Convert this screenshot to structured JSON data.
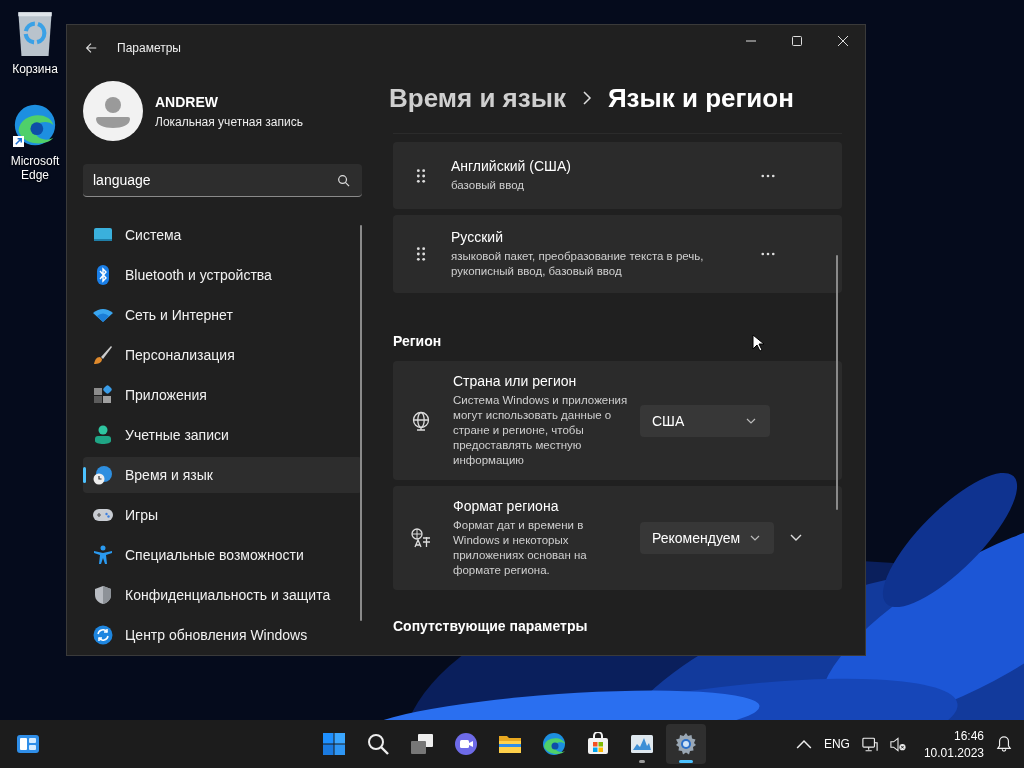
{
  "desktop_icons": [
    {
      "kind": "recycle",
      "label": "Корзина"
    },
    {
      "kind": "edge",
      "label": "Microsoft Edge"
    }
  ],
  "window": {
    "title": "Параметры"
  },
  "user": {
    "name": "ANDREW",
    "account_type": "Локальная учетная запись"
  },
  "search": {
    "value": "language"
  },
  "nav": [
    {
      "kind": "system",
      "label": "Система",
      "selected": false
    },
    {
      "kind": "bluetooth",
      "label": "Bluetooth и устройства",
      "selected": false
    },
    {
      "kind": "network",
      "label": "Сеть и Интернет",
      "selected": false
    },
    {
      "kind": "personalization",
      "label": "Персонализация",
      "selected": false
    },
    {
      "kind": "apps",
      "label": "Приложения",
      "selected": false
    },
    {
      "kind": "accounts",
      "label": "Учетные записи",
      "selected": false
    },
    {
      "kind": "time",
      "label": "Время и язык",
      "selected": true
    },
    {
      "kind": "gaming",
      "label": "Игры",
      "selected": false
    },
    {
      "kind": "accessibility",
      "label": "Специальные возможности",
      "selected": false
    },
    {
      "kind": "privacy",
      "label": "Конфиденциальность и защита",
      "selected": false
    },
    {
      "kind": "update",
      "label": "Центр обновления Windows",
      "selected": false
    }
  ],
  "breadcrumb": {
    "parent": "Время и язык",
    "current": "Язык и регион"
  },
  "languages": [
    {
      "name": "Английский (США)",
      "features": "базовый ввод"
    },
    {
      "name": "Русский",
      "features": "языковой пакет, преобразование текста в речь, рукописный ввод, базовый ввод"
    }
  ],
  "region": {
    "heading": "Регион",
    "settings": [
      {
        "kind": "globe",
        "title": "Страна или регион",
        "description": "Система Windows и приложения могут использовать данные о стране и регионе, чтобы предоставлять местную информацию",
        "value": "США",
        "expandable": false
      },
      {
        "kind": "format",
        "title": "Формат региона",
        "description": "Формат дат и времени в Windows и некоторых приложениях основан на формате региона.",
        "value": "Рекомендуем",
        "expandable": true
      }
    ]
  },
  "related_heading": "Сопутствующие параметры",
  "taskbar": {
    "apps": [
      {
        "kind": "start",
        "running": false,
        "selected": false
      },
      {
        "kind": "search",
        "running": false,
        "selected": false
      },
      {
        "kind": "taskview",
        "running": false,
        "selected": false
      },
      {
        "kind": "chat",
        "running": false,
        "selected": false
      },
      {
        "kind": "explorer",
        "running": false,
        "selected": false
      },
      {
        "kind": "edge",
        "running": false,
        "selected": false
      },
      {
        "kind": "store",
        "running": false,
        "selected": false
      },
      {
        "kind": "monitor",
        "running": true,
        "selected": false
      },
      {
        "kind": "settings",
        "running": true,
        "selected": true
      }
    ],
    "language": "ENG",
    "sound_muted": true,
    "time": "16:46",
    "date": "10.01.2023"
  }
}
